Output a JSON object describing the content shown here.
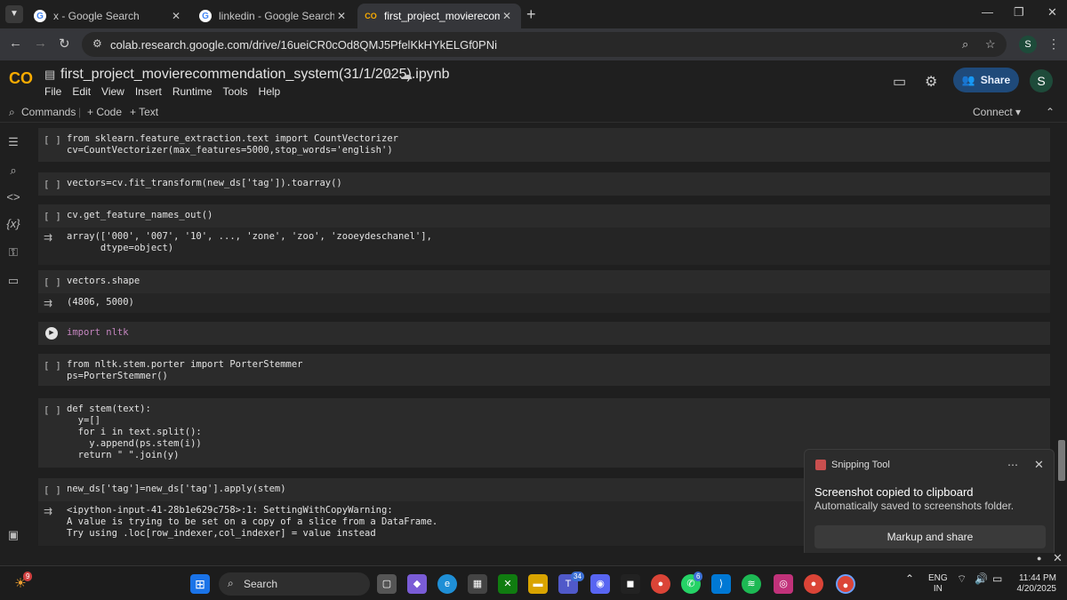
{
  "browser": {
    "tabs": [
      {
        "title": "x - Google Search",
        "close": "✕"
      },
      {
        "title": "linkedin - Google Search",
        "close": "✕"
      },
      {
        "title": "first_project_movierecommend",
        "close": "✕"
      }
    ],
    "url": "colab.research.google.com/drive/16ueiCR0cOd8QMJ5PfelKkHYkELGf0PNi",
    "profile_initial": "S"
  },
  "colab": {
    "logo": "CO",
    "notebook_title": "first_project_movierecommendation_system(31/1/2025).ipynb",
    "menu": [
      "File",
      "Edit",
      "View",
      "Insert",
      "Runtime",
      "Tools",
      "Help"
    ],
    "share_label": "Share",
    "user_initial": "S",
    "toolbar": {
      "commands": "Commands",
      "code": "+ Code",
      "text": "+ Text",
      "connect": "Connect"
    }
  },
  "cells": [
    {
      "bracket": "[ ]",
      "lines": [
        "from sklearn.feature_extraction.text import CountVectorizer",
        "cv=CountVectorizer(max_features=5000,stop_words='english')"
      ]
    },
    {
      "bracket": "[ ]",
      "lines": [
        "vectors=cv.fit_transform(new_ds['tag']).toarray()"
      ]
    },
    {
      "bracket": "[ ]",
      "lines": [
        "cv.get_feature_names_out()"
      ],
      "output": [
        "array(['000', '007', '10', ..., 'zone', 'zoo', 'zooeydeschanel'],",
        "      dtype=object)"
      ]
    },
    {
      "bracket": "[ ]",
      "lines": [
        "vectors.shape"
      ],
      "output": [
        "(4806, 5000)"
      ]
    },
    {
      "bracket": "",
      "lines": [
        "import nltk"
      ]
    },
    {
      "bracket": "[ ]",
      "lines": [
        "from nltk.stem.porter import PorterStemmer",
        "ps=PorterStemmer()"
      ]
    },
    {
      "bracket": "[ ]",
      "lines": [
        "def stem(text):",
        "  y=[]",
        "  for i in text.split():",
        "    y.append(ps.stem(i))",
        "  return \" \".join(y)"
      ]
    },
    {
      "bracket": "[ ]",
      "lines": [
        "new_ds['tag']=new_ds['tag'].apply(stem)"
      ],
      "output": [
        "<ipython-input-41-28b1e629c758>:1: SettingWithCopyWarning:",
        "A value is trying to be set on a copy of a slice from a DataFrame.",
        "Try using .loc[row_indexer,col_indexer] = value instead"
      ]
    }
  ],
  "toast": {
    "app": "Snipping Tool",
    "title": "Screenshot copied to clipboard",
    "subtitle": "Automatically saved to screenshots folder.",
    "button": "Markup and share"
  },
  "taskbar": {
    "weather_badge": "9",
    "search_label": "Search",
    "teams_badge": "34",
    "whatsapp_badge": "6",
    "lang_top": "ENG",
    "lang_bottom": "IN",
    "time": "11:44 PM",
    "date": "4/20/2025"
  }
}
